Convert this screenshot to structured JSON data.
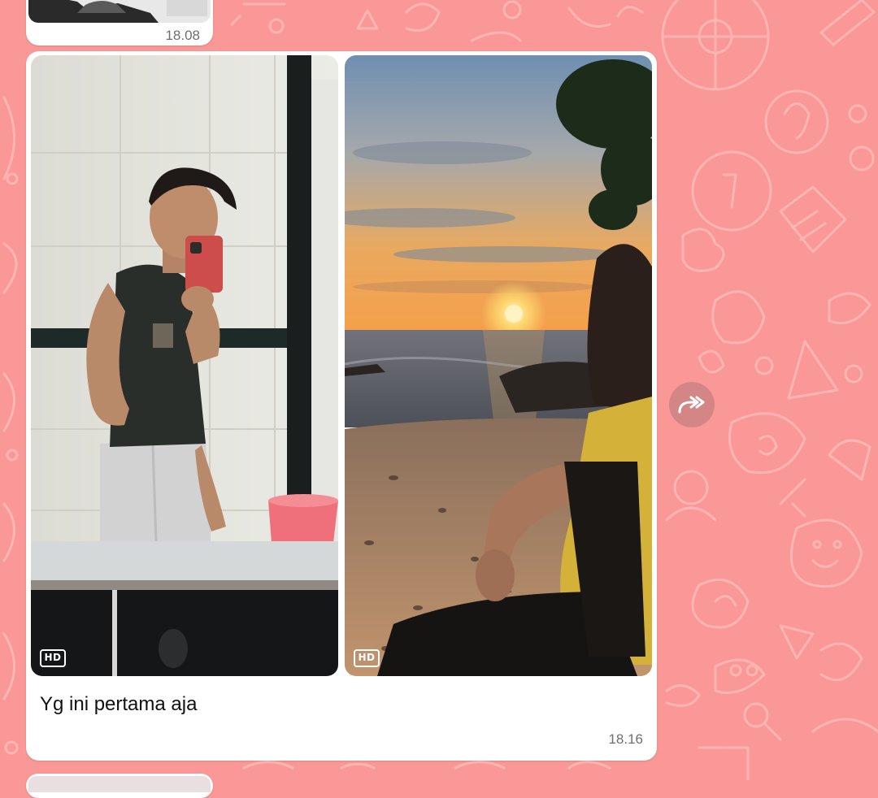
{
  "colors": {
    "wallpaper": "#f99896",
    "bubble": "#ffffff",
    "timestamp": "#6f6f6f"
  },
  "previous_message": {
    "time": "18.08"
  },
  "message": {
    "caption": "Yg ini pertama aja",
    "time": "18.16",
    "photos": [
      {
        "label": "mirror-selfie-photo",
        "badge": "HD"
      },
      {
        "label": "beach-sunset-photo",
        "badge": "HD"
      }
    ]
  },
  "forward_button": {
    "icon": "forward-arrow-icon"
  }
}
